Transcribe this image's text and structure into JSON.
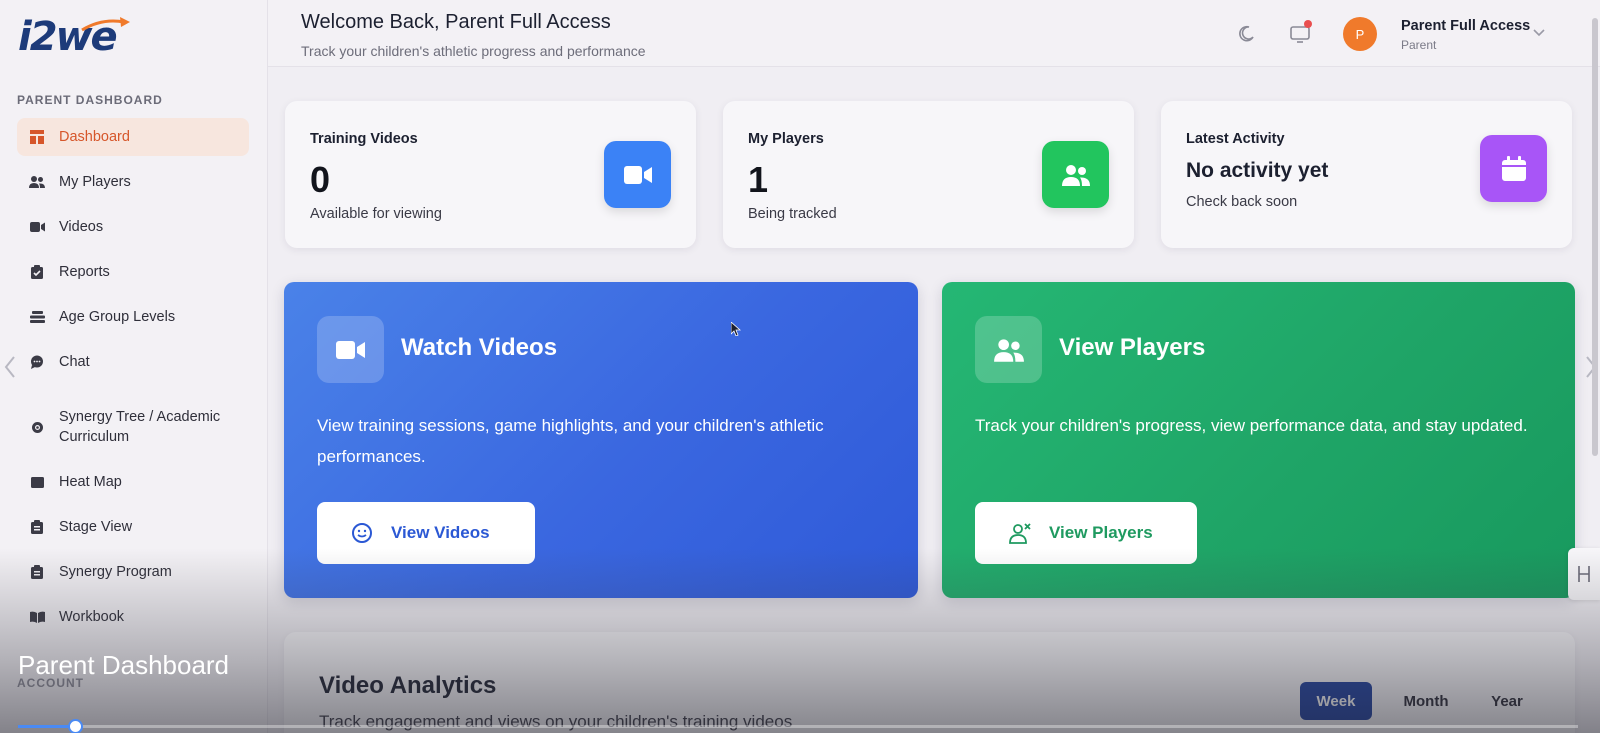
{
  "brand": {
    "logo_text": "i2we"
  },
  "sidebar": {
    "section_label": "PARENT DASHBOARD",
    "items": [
      {
        "label": "Dashboard",
        "icon": "dashboard-icon",
        "active": true
      },
      {
        "label": "My Players",
        "icon": "users-icon"
      },
      {
        "label": "Videos",
        "icon": "video-icon"
      },
      {
        "label": "Reports",
        "icon": "clipboard-icon"
      },
      {
        "label": "Age Group Levels",
        "icon": "layers-icon"
      },
      {
        "label": "Chat",
        "icon": "chat-icon"
      },
      {
        "label": "Synergy Tree / Academic Curriculum",
        "icon": "gear-icon"
      },
      {
        "label": "Heat Map",
        "icon": "heatmap-icon"
      },
      {
        "label": "Stage View",
        "icon": "clipboard-icon"
      },
      {
        "label": "Synergy Program",
        "icon": "clipboard-icon"
      },
      {
        "label": "Workbook",
        "icon": "book-icon"
      }
    ],
    "account_label": "ACCOUNT"
  },
  "header": {
    "welcome": "Welcome Back, Parent Full Access",
    "subtitle": "Track your children's athletic progress and performance",
    "user": {
      "initial": "P",
      "name": "Parent Full Access",
      "role": "Parent"
    }
  },
  "stats": [
    {
      "label": "Training Videos",
      "value": "0",
      "sub": "Available for viewing",
      "color": "#3b82f6",
      "icon": "video-icon"
    },
    {
      "label": "My Players",
      "value": "1",
      "sub": "Being tracked",
      "color": "#22c55e",
      "icon": "users-icon"
    },
    {
      "label": "Latest Activity",
      "value": "No activity yet",
      "sub": "Check back soon",
      "color": "#a855f7",
      "icon": "calendar-icon"
    }
  ],
  "actions": {
    "videos": {
      "title": "Watch Videos",
      "description": "View training sessions, game highlights, and your children's athletic performances.",
      "button": "View Videos"
    },
    "players": {
      "title": "View Players",
      "description": "Track your children's progress, view performance data, and stay updated.",
      "button": "View Players"
    }
  },
  "analytics": {
    "title": "Video Analytics",
    "subtitle": "Track engagement and views on your children's training videos",
    "ranges": [
      "Week",
      "Month",
      "Year"
    ],
    "selected_range": "Week"
  },
  "overlay": {
    "caption": "Parent Dashboard",
    "progress_fraction": 0.037
  },
  "colors": {
    "accent_orange": "#d6562a",
    "blue_card": "#3a67e0",
    "green_card": "#1fa567",
    "active_range": "#1e3f9e"
  }
}
